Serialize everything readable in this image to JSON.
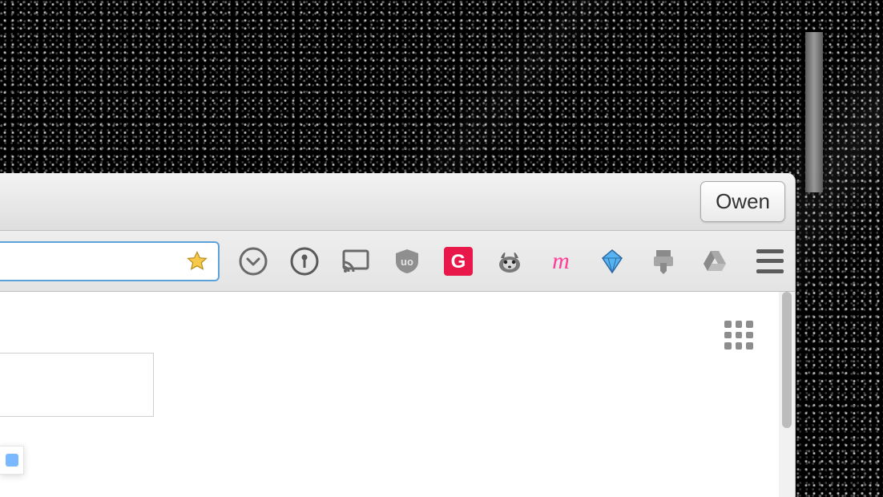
{
  "profile": {
    "label": "Owen"
  },
  "extensions": [
    {
      "id": "pocket",
      "name": "pocket-icon"
    },
    {
      "id": "onepass",
      "name": "onepassword-icon"
    },
    {
      "id": "cast",
      "name": "cast-icon"
    },
    {
      "id": "ublock",
      "name": "ublock-icon"
    },
    {
      "id": "g",
      "name": "g-extension-icon",
      "letter": "G",
      "bg": "#e8194a"
    },
    {
      "id": "badger",
      "name": "privacy-badger-icon"
    },
    {
      "id": "m",
      "name": "m-extension-icon",
      "letter": "m",
      "color": "#ff3e97"
    },
    {
      "id": "funnel",
      "name": "funnel-extension-icon"
    },
    {
      "id": "download",
      "name": "download-icon"
    },
    {
      "id": "drive",
      "name": "google-drive-icon"
    }
  ]
}
